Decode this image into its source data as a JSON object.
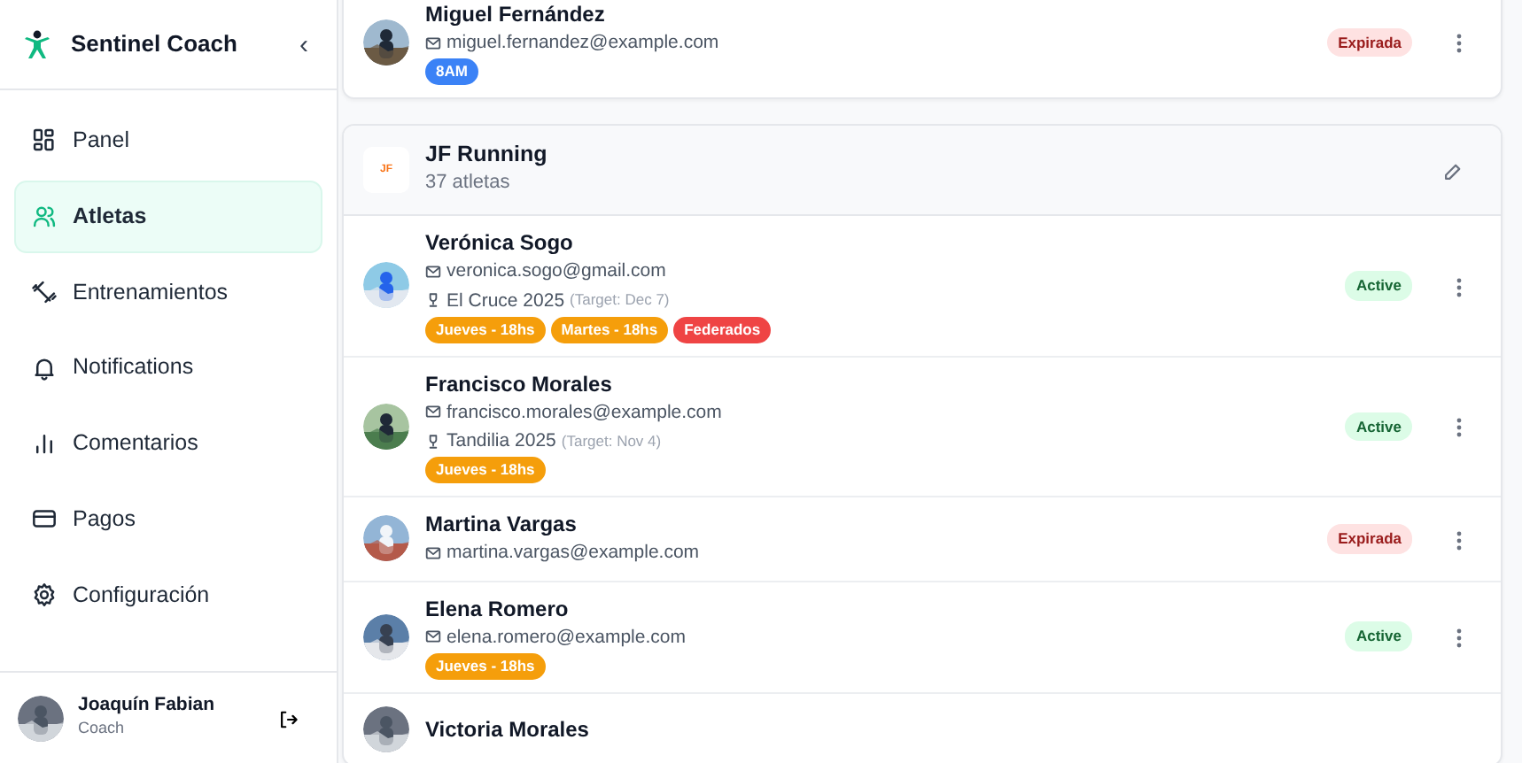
{
  "sidebar": {
    "brand": "Sentinel Coach",
    "collapse_icon": "‹",
    "items": [
      {
        "label": "Panel",
        "selected": false
      },
      {
        "label": "Atletas",
        "selected": true
      },
      {
        "label": "Entrenamientos",
        "selected": false
      },
      {
        "label": "Notifications",
        "selected": false
      },
      {
        "label": "Comentarios",
        "selected": false
      },
      {
        "label": "Pagos",
        "selected": false
      },
      {
        "label": "Configuración",
        "selected": false
      }
    ],
    "user": {
      "name": "Joaquín Fabian",
      "role": "Coach"
    }
  },
  "groups": [
    {
      "athletes": [
        {
          "name": "Miguel Fernández",
          "email": "miguel.fernandez@example.com",
          "tags": [
            {
              "label": "8AM",
              "color": "#3b82f6"
            }
          ],
          "status": "Expirada",
          "kind": "expired"
        }
      ]
    },
    {
      "header": {
        "logo_text": "JF",
        "title": "JF Running",
        "count": "37 atletas"
      },
      "athletes": [
        {
          "name": "Verónica Sogo",
          "email": "veronica.sogo@gmail.com",
          "goal": "El Cruce 2025",
          "target": "(Target: Dec 7)",
          "tags": [
            {
              "label": "Jueves - 18hs",
              "color": "#f59e0b"
            },
            {
              "label": "Martes - 18hs",
              "color": "#f59e0b"
            },
            {
              "label": "Federados",
              "color": "#ef4444"
            }
          ],
          "status": "Active",
          "kind": "active"
        },
        {
          "name": "Francisco Morales",
          "email": "francisco.morales@example.com",
          "goal": "Tandilia 2025",
          "target": "(Target: Nov 4)",
          "tags": [
            {
              "label": "Jueves - 18hs",
              "color": "#f59e0b"
            }
          ],
          "status": "Active",
          "kind": "active"
        },
        {
          "name": "Martina Vargas",
          "email": "martina.vargas@example.com",
          "status": "Expirada",
          "kind": "expired"
        },
        {
          "name": "Elena Romero",
          "email": "elena.romero@example.com",
          "tags": [
            {
              "label": "Jueves - 18hs",
              "color": "#f59e0b"
            }
          ],
          "status": "Active",
          "kind": "active"
        },
        {
          "name": "Victoria Morales"
        }
      ]
    }
  ]
}
